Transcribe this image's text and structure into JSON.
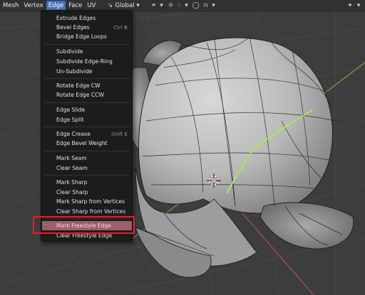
{
  "header": {
    "menus": [
      "Mesh",
      "Vertex",
      "Edge",
      "Face",
      "UV"
    ],
    "active_menu": "Edge",
    "orientation": "Global",
    "icons": [
      "orientation-icon",
      "pivot-icon",
      "snap-icon",
      "proportional-icon",
      "falloff-icon",
      "gizmo-icon"
    ]
  },
  "edge_menu": {
    "items": [
      {
        "label": "Extrude Edges",
        "shortcut": ""
      },
      {
        "label": "Bevel Edges",
        "shortcut": "Ctrl B"
      },
      {
        "label": "Bridge Edge Loops",
        "shortcut": ""
      },
      {
        "label": "Subdivide",
        "shortcut": ""
      },
      {
        "label": "Subdivide Edge-Ring",
        "shortcut": ""
      },
      {
        "label": "Un-Subdivide",
        "shortcut": ""
      },
      {
        "label": "Rotate Edge CW",
        "shortcut": ""
      },
      {
        "label": "Rotate Edge CCW",
        "shortcut": ""
      },
      {
        "label": "Edge Slide",
        "shortcut": ""
      },
      {
        "label": "Edge Split",
        "shortcut": ""
      },
      {
        "label": "Edge Crease",
        "shortcut": "Shift E"
      },
      {
        "label": "Edge Bevel Weight",
        "shortcut": ""
      },
      {
        "label": "Mark Seam",
        "shortcut": ""
      },
      {
        "label": "Clear Seam",
        "shortcut": ""
      },
      {
        "label": "Mark Sharp",
        "shortcut": ""
      },
      {
        "label": "Clear Sharp",
        "shortcut": ""
      },
      {
        "label": "Mark Sharp from Vertices",
        "shortcut": ""
      },
      {
        "label": "Clear Sharp from Vertices",
        "shortcut": ""
      },
      {
        "label": "Mark Freestyle Edge",
        "shortcut": ""
      },
      {
        "label": "Clear Freestyle Edge",
        "shortcut": ""
      }
    ],
    "highlighted_item": "Mark Freestyle Edge"
  },
  "colors": {
    "menu_bg": "#1c1c1c",
    "active_menu": "#4772b3",
    "highlight": "#9e5e6c",
    "annotation_box": "#e32028",
    "selected_edge": "#a4e85a"
  }
}
